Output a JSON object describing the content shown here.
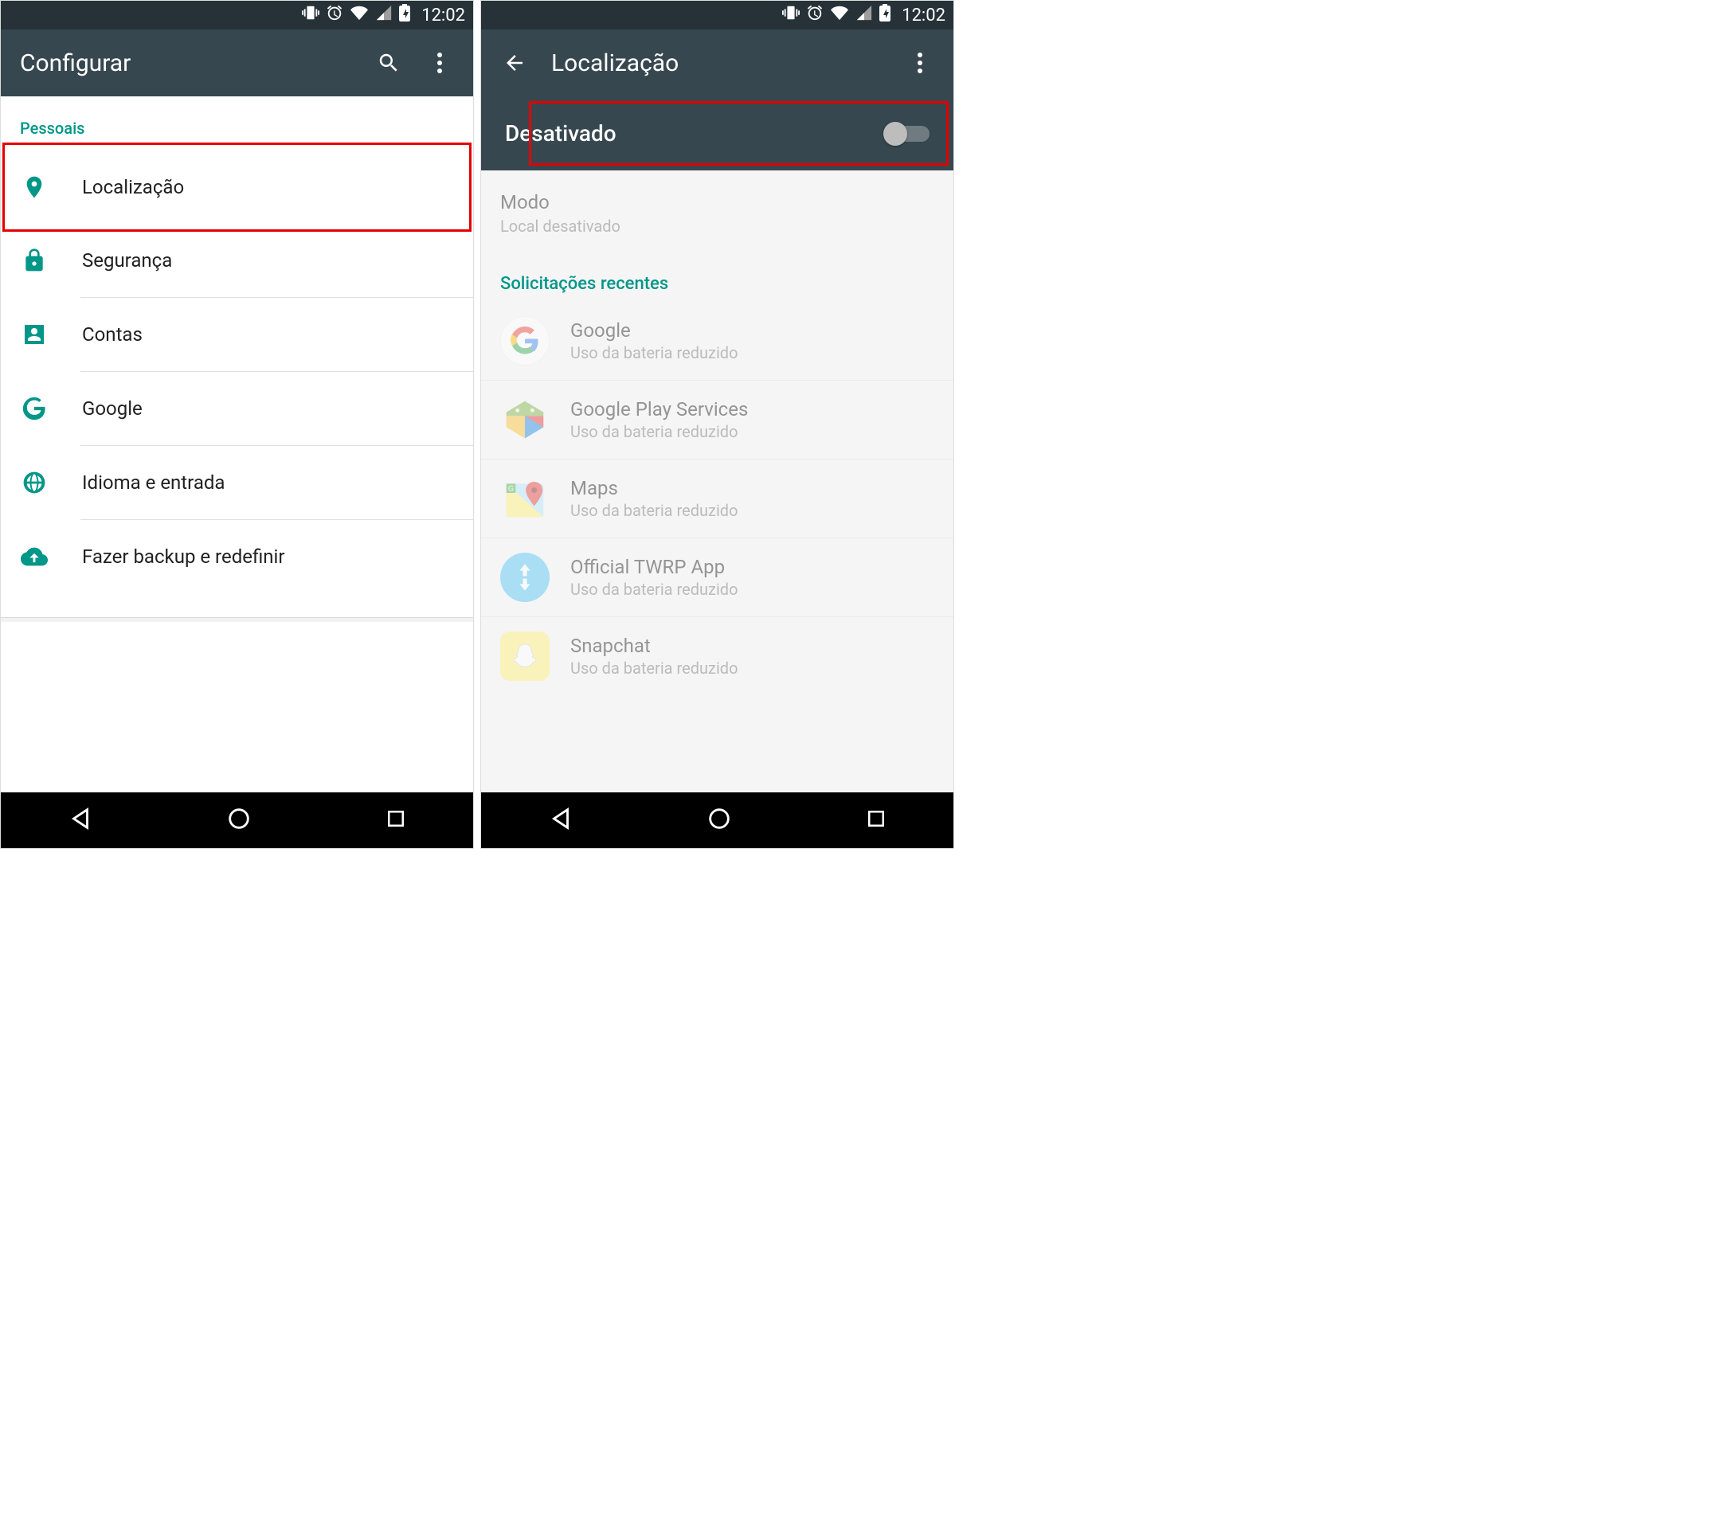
{
  "status": {
    "time": "12:02"
  },
  "left": {
    "title": "Configurar",
    "section": "Pessoais",
    "items": [
      {
        "label": "Localização",
        "icon": "location"
      },
      {
        "label": "Segurança",
        "icon": "lock"
      },
      {
        "label": "Contas",
        "icon": "account"
      },
      {
        "label": "Google",
        "icon": "google"
      },
      {
        "label": "Idioma e entrada",
        "icon": "globe"
      },
      {
        "label": "Fazer backup e redefinir",
        "icon": "cloud-up"
      }
    ]
  },
  "right": {
    "title": "Localização",
    "toggle_label": "Desativado",
    "toggle_on": false,
    "mode_title": "Modo",
    "mode_sub": "Local desativado",
    "recent_header": "Solicitações recentes",
    "apps": [
      {
        "name": "Google",
        "usage": "Uso da bateria reduzido",
        "icon": "google-g"
      },
      {
        "name": "Google Play Services",
        "usage": "Uso da bateria reduzido",
        "icon": "play-services"
      },
      {
        "name": "Maps",
        "usage": "Uso da bateria reduzido",
        "icon": "maps"
      },
      {
        "name": "Official TWRP App",
        "usage": "Uso da bateria reduzido",
        "icon": "twrp"
      },
      {
        "name": "Snapchat",
        "usage": "Uso da bateria reduzido",
        "icon": "snapchat"
      }
    ]
  }
}
